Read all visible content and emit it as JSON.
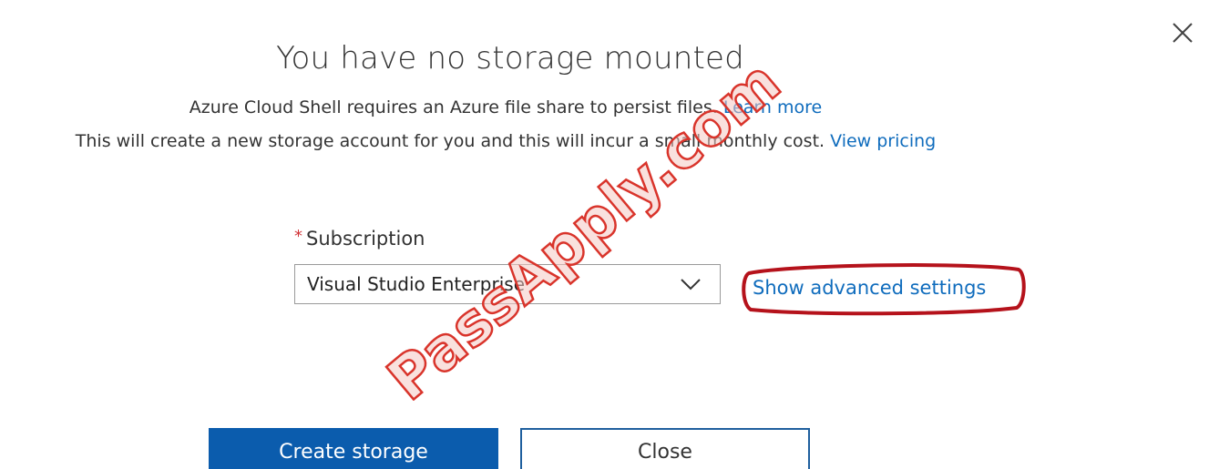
{
  "dialog": {
    "close_icon": "close-icon",
    "title": "You have no storage mounted",
    "line1": {
      "text": "Azure Cloud Shell requires an Azure file share to persist files.",
      "link": "Learn more"
    },
    "line2": {
      "text": "This will create a new storage account for you and this will incur a small monthly cost.",
      "link": "View pricing"
    }
  },
  "subscription": {
    "required_mark": "*",
    "label": "Subscription",
    "value": "Visual Studio Enterprise",
    "chevron_icon": "chevron-down-icon"
  },
  "advanced": {
    "link": "Show advanced settings"
  },
  "buttons": {
    "create": "Create storage",
    "close": "Close"
  },
  "watermark": {
    "text": "PassApply.com"
  },
  "colors": {
    "link": "#0f6cbd",
    "primary_button": "#0b5cad",
    "required": "#d13438",
    "highlight_ring": "#b5121b",
    "watermark": "#d9342b"
  }
}
